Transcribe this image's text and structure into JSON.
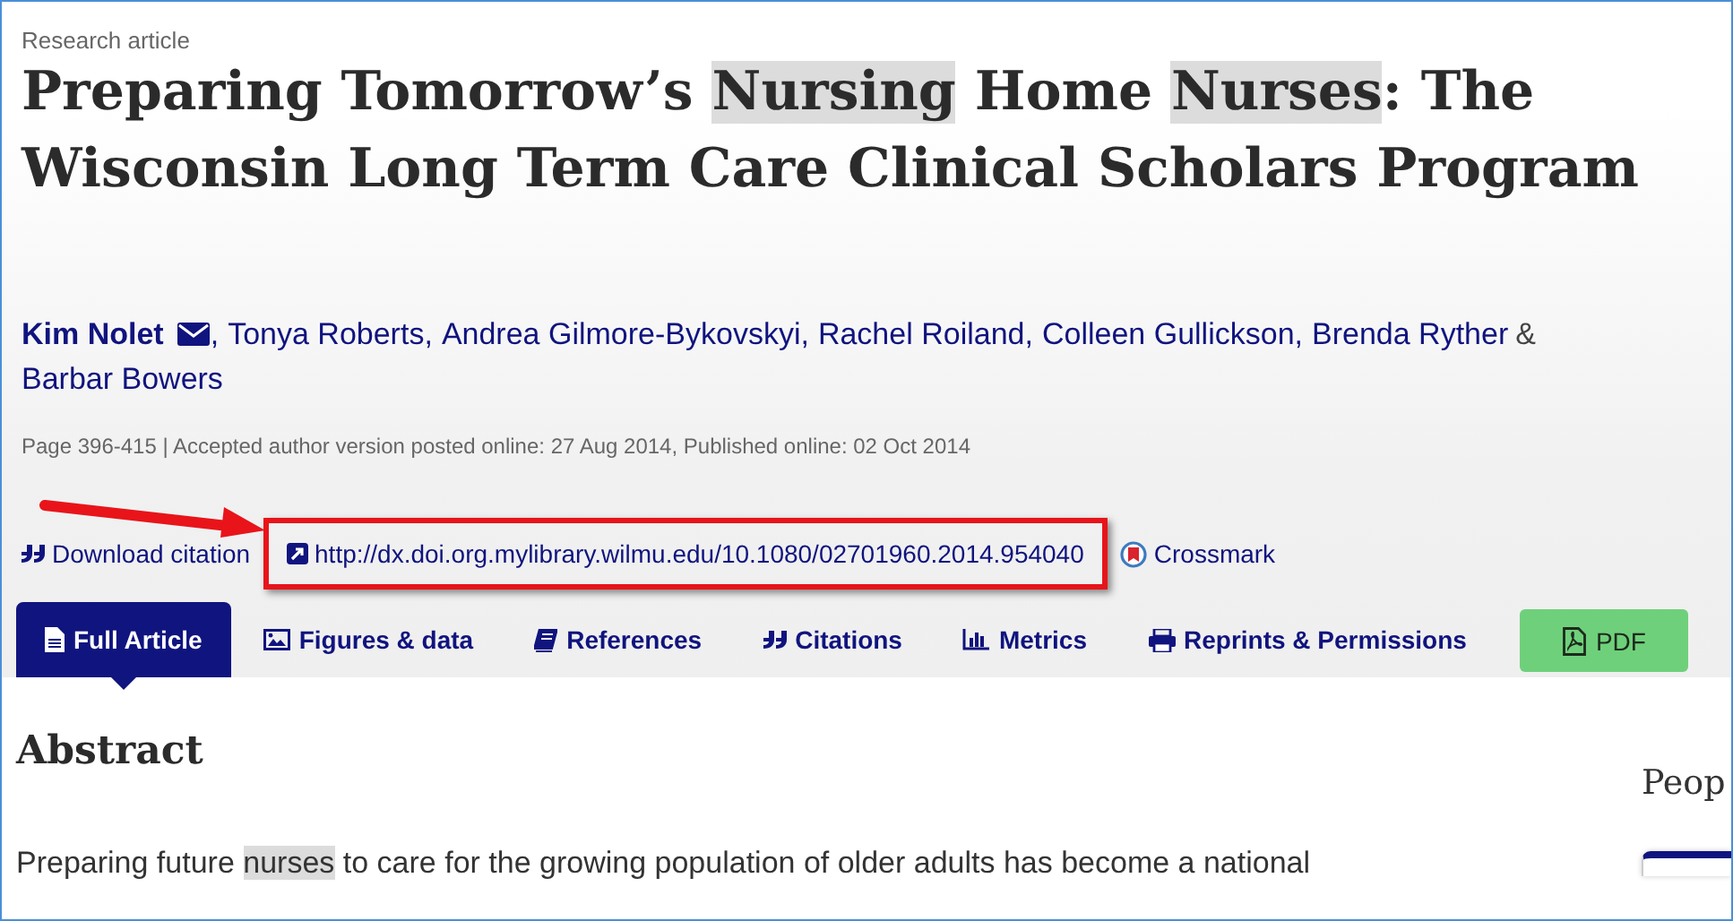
{
  "article_type": "Research article",
  "title": [
    {
      "text": "Preparing Tomorrow’s ",
      "highlighted": false
    },
    {
      "text": "Nursing",
      "highlighted": true
    },
    {
      "text": " Home ",
      "highlighted": false
    },
    {
      "text": "Nurses",
      "highlighted": true
    },
    {
      "text": ": The Wisconsin Long Term Care Clinical Scholars Program",
      "highlighted": false
    }
  ],
  "authors": [
    {
      "name": "Kim Nolet",
      "corresponding": true,
      "separator": ","
    },
    {
      "name": "Tonya Roberts",
      "corresponding": false,
      "separator": ","
    },
    {
      "name": "Andrea Gilmore-Bykovskyi",
      "corresponding": false,
      "separator": ","
    },
    {
      "name": "Rachel Roiland",
      "corresponding": false,
      "separator": ","
    },
    {
      "name": "Colleen Gullickson",
      "corresponding": false,
      "separator": ","
    },
    {
      "name": "Brenda Ryther",
      "corresponding": false,
      "separator": "&"
    },
    {
      "name": "Barbar Bowers",
      "corresponding": false
    }
  ],
  "meta": "Page 396-415 | Accepted author version posted online: 27 Aug 2014, Published online: 02 Oct 2014",
  "links": [
    {
      "kind": "citation",
      "label": "Download citation",
      "highlighted": false
    },
    {
      "kind": "doi",
      "label": "http://dx.doi.org.mylibrary.wilmu.edu/10.1080/02701960.2014.954040",
      "highlighted": true
    },
    {
      "kind": "crossmark",
      "label": "Crossmark",
      "highlighted": false
    }
  ],
  "tabs": [
    {
      "kind": "article",
      "label": "Full Article",
      "selected": true
    },
    {
      "kind": "figures",
      "label": "Figures & data",
      "selected": false
    },
    {
      "kind": "references",
      "label": "References",
      "selected": false
    },
    {
      "kind": "citations",
      "label": "Citations",
      "selected": false
    },
    {
      "kind": "metrics",
      "label": "Metrics",
      "selected": false
    },
    {
      "kind": "reprints",
      "label": "Reprints & Permissions",
      "selected": false
    },
    {
      "kind": "pdf",
      "label": "PDF",
      "selected": false
    }
  ],
  "abstract": {
    "heading": "Abstract",
    "text": [
      {
        "text": "Preparing future ",
        "highlighted": false
      },
      {
        "text": "nurses",
        "highlighted": true
      },
      {
        "text": " to care for the growing population of older adults has become a national",
        "highlighted": false
      }
    ]
  },
  "sidebar": {
    "heading": "Peop"
  }
}
